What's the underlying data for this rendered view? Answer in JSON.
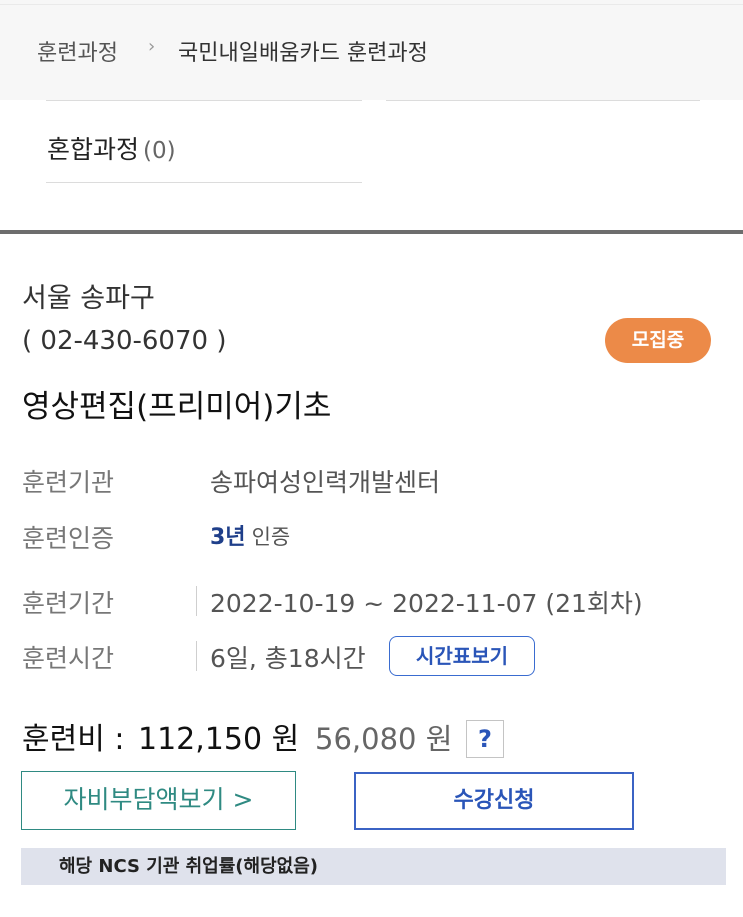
{
  "breadcrumb": {
    "home": "훈련과정",
    "separator": "›",
    "current": "국민내일배움카드 훈련과정"
  },
  "category": {
    "label": "혼합과정",
    "count": "(0)"
  },
  "course": {
    "location": "서울 송파구",
    "phone": "( 02-430-6070 )",
    "status_badge": "모집중",
    "title": "영상편집(프리미어)기초",
    "institution_label": "훈련기관",
    "institution_value": "송파여성인력개발센터",
    "certification_label": "훈련인증",
    "certification_years": "3년",
    "certification_suffix": "인증",
    "period_label": "훈련기간",
    "period_value": "2022-10-19 ~ 2022-11-07 (21회차)",
    "hours_label": "훈련시간",
    "hours_value": "6일, 총18시간",
    "timetable_button": "시간표보기",
    "fee_label": "훈련비 :",
    "fee_full": "112,150 원",
    "fee_discount": "56,080 원",
    "help_button": "?",
    "selfpay_button": "자비부담액보기 >",
    "apply_button": "수강신청",
    "ncs_bar": "해당 NCS 기관 취업률(해당없음)"
  },
  "colors": {
    "badge": "#ec8a48",
    "accent_blue": "#2a55b8",
    "accent_teal": "#2f8a82",
    "ncs_bar_bg": "#dfe2ec"
  }
}
